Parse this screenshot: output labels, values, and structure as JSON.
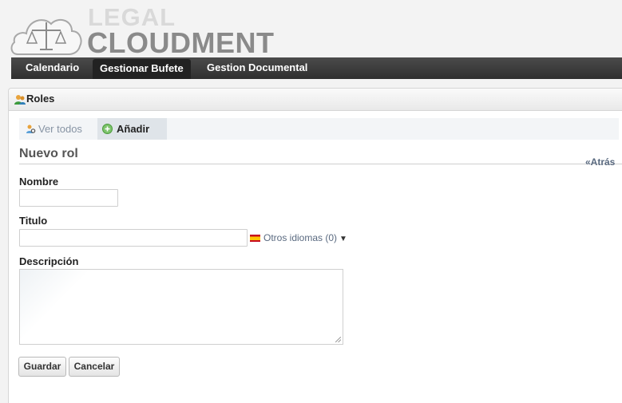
{
  "logo": {
    "line1": "LEGAL",
    "line2": "CLOUDMENT"
  },
  "nav": {
    "items": [
      {
        "label": "Calendario",
        "active": false
      },
      {
        "label": "Gestionar Bufete",
        "active": true
      },
      {
        "label": "Gestion Documental",
        "active": false
      }
    ]
  },
  "panel": {
    "title": "Roles",
    "icon": "users-icon"
  },
  "tabs": {
    "ver_todos": {
      "label": "Ver todos",
      "icon": "user-search-icon"
    },
    "anadir": {
      "label": "Añadir",
      "icon": "plus-circle-icon",
      "active": true
    }
  },
  "section": {
    "title": "Nuevo rol",
    "back_label": "«Atrás"
  },
  "form": {
    "nombre": {
      "label": "Nombre",
      "value": ""
    },
    "titulo": {
      "label": "Titulo",
      "value": ""
    },
    "otros_idiomas": {
      "label": "Otros idiomas (0)",
      "flag": "spain-flag-icon"
    },
    "descripcion": {
      "label": "Descripción",
      "value": ""
    }
  },
  "buttons": {
    "save": "Guardar",
    "cancel": "Cancelar"
  },
  "colors": {
    "navbar": "#3c3c3c",
    "link": "#5a6a80",
    "tab_active": "#dfe4e9"
  }
}
